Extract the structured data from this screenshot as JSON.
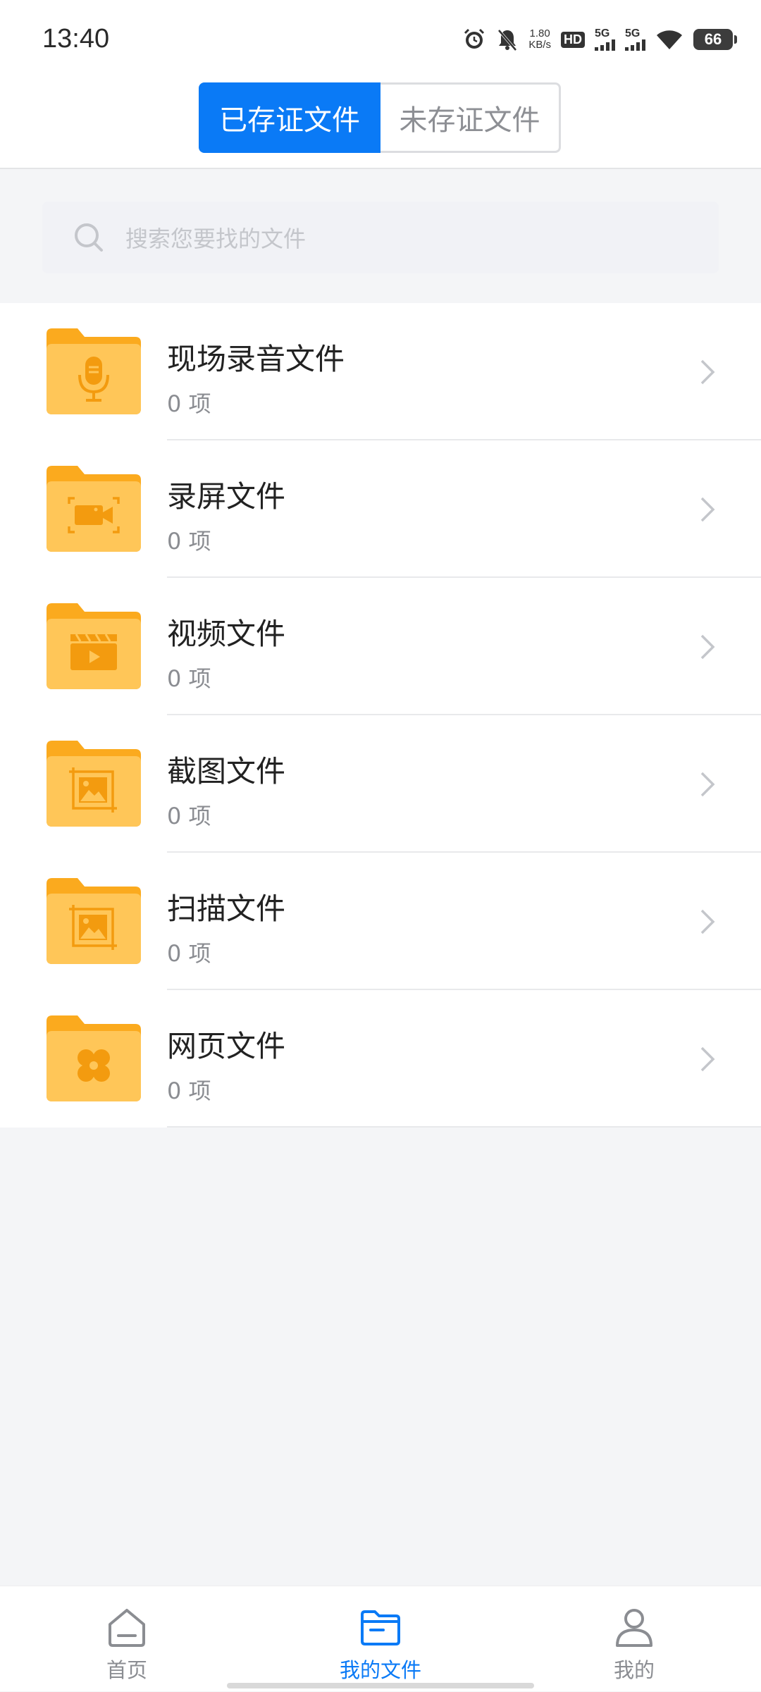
{
  "status_bar": {
    "time": "13:40",
    "speed_value": "1.80",
    "speed_unit": "KB/s",
    "hd": "HD",
    "network1": "5G",
    "network2": "5G",
    "battery": "66"
  },
  "tabs": {
    "active_label": "已存证文件",
    "inactive_label": "未存证文件"
  },
  "search": {
    "placeholder": "搜索您要找的文件"
  },
  "folders": [
    {
      "title": "现场录音文件",
      "count": "0 项",
      "icon": "microphone-icon"
    },
    {
      "title": "录屏文件",
      "count": "0 项",
      "icon": "screen-record-icon"
    },
    {
      "title": "视频文件",
      "count": "0 项",
      "icon": "video-clapper-icon"
    },
    {
      "title": "截图文件",
      "count": "0 项",
      "icon": "screenshot-icon"
    },
    {
      "title": "扫描文件",
      "count": "0 项",
      "icon": "scan-icon"
    },
    {
      "title": "网页文件",
      "count": "0 项",
      "icon": "webpage-icon"
    }
  ],
  "bottom_nav": {
    "home_label": "首页",
    "files_label": "我的文件",
    "mine_label": "我的"
  },
  "colors": {
    "accent": "#0a7af6",
    "folder_back": "#fbaa1e",
    "folder_front": "#ffc658",
    "folder_glyph": "#f39b0f"
  }
}
